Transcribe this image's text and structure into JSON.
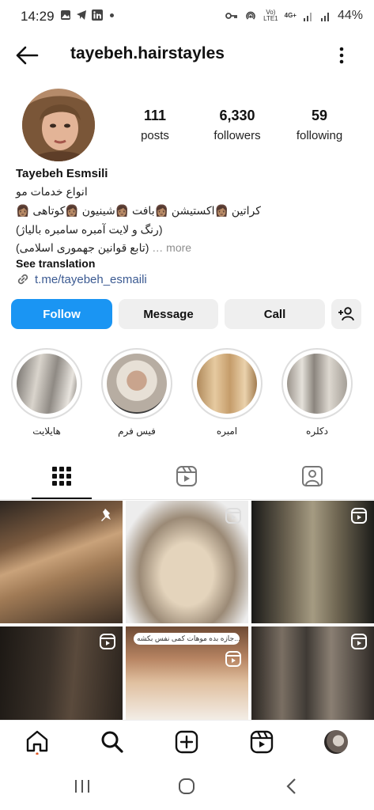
{
  "status_bar": {
    "time": "14:29",
    "network_top": "Vo)",
    "network_bottom": "LTE1",
    "net_type": "4G+",
    "battery": "44%"
  },
  "header": {
    "username": "tayebeh.hairstayles"
  },
  "profile": {
    "stats": [
      {
        "value": "111",
        "label": "posts"
      },
      {
        "value": "6,330",
        "label": "followers"
      },
      {
        "value": "59",
        "label": "following"
      }
    ],
    "name": "Tayebeh Esmsili",
    "bio_lines": [
      "انواع خدمات مو",
      "کراتین 👩🏽اکستیشن 👩🏽بافت 👩🏽شینیون 👩🏽کوتاهی 👩🏽",
      "(رنگ و لایت آمبره سامبره بالیاژ)"
    ],
    "bio_last": "(تابع قوانین جهموری اسلامی)",
    "more_label": "… more",
    "see_translation": "See translation",
    "link": "t.me/tayebeh_esmaili"
  },
  "actions": {
    "follow": "Follow",
    "message": "Message",
    "call": "Call"
  },
  "highlights": [
    {
      "label": "هایلایت"
    },
    {
      "label": "فیس فرم"
    },
    {
      "label": "امبره"
    },
    {
      "label": "دکلره"
    }
  ],
  "grid_captions": {
    "post5": "جازه بده موهات کمی نفس بکشه..."
  },
  "colors": {
    "follow_blue": "#1a95f3",
    "link_blue": "#3b5a92"
  }
}
